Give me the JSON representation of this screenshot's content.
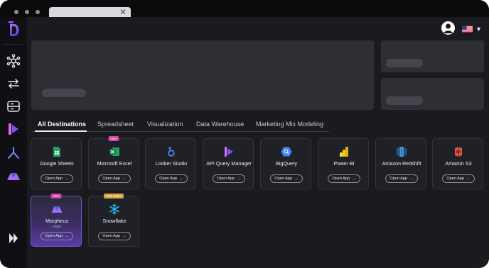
{
  "browser": {
    "tab_close": "✕"
  },
  "sidebar": {
    "items": [
      {
        "name": "network"
      },
      {
        "name": "transfer"
      },
      {
        "name": "dashboard"
      },
      {
        "name": "reports"
      },
      {
        "name": "connector"
      },
      {
        "name": "morpheus"
      },
      {
        "name": "expand"
      }
    ]
  },
  "tabs": [
    {
      "label": "All Destinations",
      "active": true
    },
    {
      "label": "Spreadsheet"
    },
    {
      "label": "Visualization"
    },
    {
      "label": "Data Warehouse"
    },
    {
      "label": "Marketing Mix Modeling"
    }
  ],
  "open_app_label": "Open App",
  "arrow": "→",
  "destinations": [
    {
      "name": "Google Sheets",
      "icon": "google-sheets-icon"
    },
    {
      "name": "Microsoft Excel",
      "icon": "excel-icon",
      "badge": "New"
    },
    {
      "name": "Looker Studio",
      "icon": "looker-studio-icon"
    },
    {
      "name": "API Query Manager",
      "icon": "api-query-manager-icon"
    },
    {
      "name": "BigQuery",
      "icon": "bigquery-icon"
    },
    {
      "name": "Power BI",
      "icon": "power-bi-icon"
    },
    {
      "name": "Amazon Redshift",
      "icon": "amazon-redshift-icon"
    },
    {
      "name": "Amazon S3",
      "icon": "amazon-s3-icon"
    },
    {
      "name": "Morpheus",
      "icon": "morpheus-icon",
      "badge": "New",
      "sub": "FREE"
    },
    {
      "name": "Snowflake",
      "icon": "snowflake-icon",
      "badge": "Trial option"
    }
  ],
  "colors": {
    "accent_purple": "#6a5acd",
    "badge_new": "#d63fa5",
    "badge_trial": "#d8a23a"
  }
}
